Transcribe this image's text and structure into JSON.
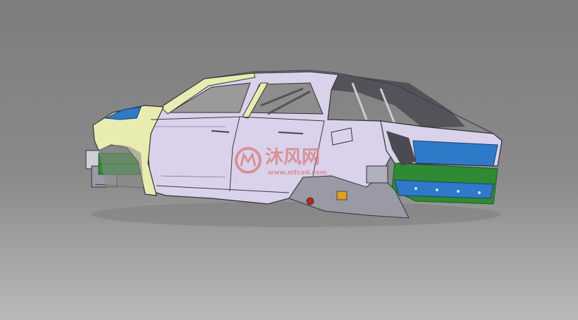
{
  "viewport": {
    "background_top": "#7d7d7d",
    "background_bottom": "#b9b9b9"
  },
  "model": {
    "panel_colors": {
      "body": "#d9d2ea",
      "fender": "#e9ecb0",
      "blue": "#2f79c9",
      "green": "#2f8a34",
      "dark": "#4a4a52"
    }
  },
  "watermark": {
    "cn_text": "沐风网",
    "sub_text": "www.mfcad.com",
    "color": "#d97a7a",
    "icon": "mf-logo-icon"
  }
}
